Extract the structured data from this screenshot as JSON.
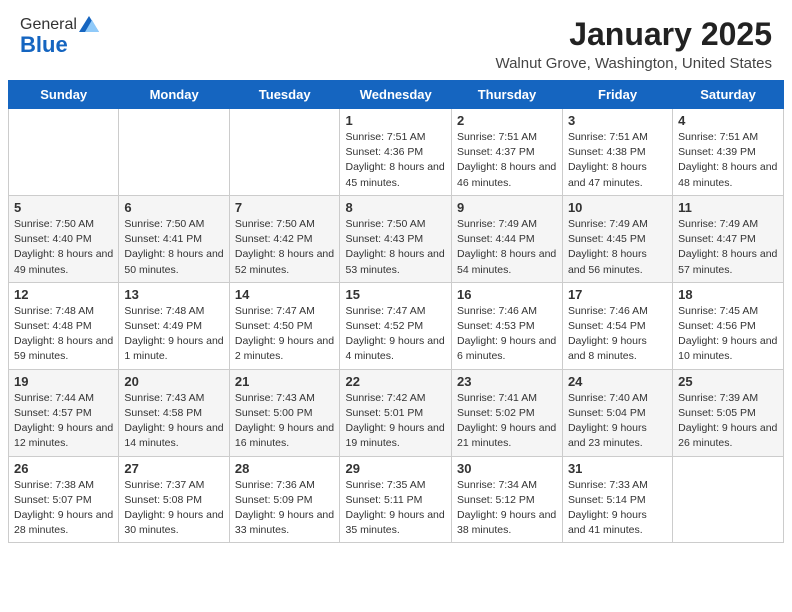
{
  "header": {
    "logo_general": "General",
    "logo_blue": "Blue",
    "month_year": "January 2025",
    "location": "Walnut Grove, Washington, United States"
  },
  "days_of_week": [
    "Sunday",
    "Monday",
    "Tuesday",
    "Wednesday",
    "Thursday",
    "Friday",
    "Saturday"
  ],
  "weeks": [
    [
      {
        "day": "",
        "info": ""
      },
      {
        "day": "",
        "info": ""
      },
      {
        "day": "",
        "info": ""
      },
      {
        "day": "1",
        "info": "Sunrise: 7:51 AM\nSunset: 4:36 PM\nDaylight: 8 hours and 45 minutes."
      },
      {
        "day": "2",
        "info": "Sunrise: 7:51 AM\nSunset: 4:37 PM\nDaylight: 8 hours and 46 minutes."
      },
      {
        "day": "3",
        "info": "Sunrise: 7:51 AM\nSunset: 4:38 PM\nDaylight: 8 hours and 47 minutes."
      },
      {
        "day": "4",
        "info": "Sunrise: 7:51 AM\nSunset: 4:39 PM\nDaylight: 8 hours and 48 minutes."
      }
    ],
    [
      {
        "day": "5",
        "info": "Sunrise: 7:50 AM\nSunset: 4:40 PM\nDaylight: 8 hours and 49 minutes."
      },
      {
        "day": "6",
        "info": "Sunrise: 7:50 AM\nSunset: 4:41 PM\nDaylight: 8 hours and 50 minutes."
      },
      {
        "day": "7",
        "info": "Sunrise: 7:50 AM\nSunset: 4:42 PM\nDaylight: 8 hours and 52 minutes."
      },
      {
        "day": "8",
        "info": "Sunrise: 7:50 AM\nSunset: 4:43 PM\nDaylight: 8 hours and 53 minutes."
      },
      {
        "day": "9",
        "info": "Sunrise: 7:49 AM\nSunset: 4:44 PM\nDaylight: 8 hours and 54 minutes."
      },
      {
        "day": "10",
        "info": "Sunrise: 7:49 AM\nSunset: 4:45 PM\nDaylight: 8 hours and 56 minutes."
      },
      {
        "day": "11",
        "info": "Sunrise: 7:49 AM\nSunset: 4:47 PM\nDaylight: 8 hours and 57 minutes."
      }
    ],
    [
      {
        "day": "12",
        "info": "Sunrise: 7:48 AM\nSunset: 4:48 PM\nDaylight: 8 hours and 59 minutes."
      },
      {
        "day": "13",
        "info": "Sunrise: 7:48 AM\nSunset: 4:49 PM\nDaylight: 9 hours and 1 minute."
      },
      {
        "day": "14",
        "info": "Sunrise: 7:47 AM\nSunset: 4:50 PM\nDaylight: 9 hours and 2 minutes."
      },
      {
        "day": "15",
        "info": "Sunrise: 7:47 AM\nSunset: 4:52 PM\nDaylight: 9 hours and 4 minutes."
      },
      {
        "day": "16",
        "info": "Sunrise: 7:46 AM\nSunset: 4:53 PM\nDaylight: 9 hours and 6 minutes."
      },
      {
        "day": "17",
        "info": "Sunrise: 7:46 AM\nSunset: 4:54 PM\nDaylight: 9 hours and 8 minutes."
      },
      {
        "day": "18",
        "info": "Sunrise: 7:45 AM\nSunset: 4:56 PM\nDaylight: 9 hours and 10 minutes."
      }
    ],
    [
      {
        "day": "19",
        "info": "Sunrise: 7:44 AM\nSunset: 4:57 PM\nDaylight: 9 hours and 12 minutes."
      },
      {
        "day": "20",
        "info": "Sunrise: 7:43 AM\nSunset: 4:58 PM\nDaylight: 9 hours and 14 minutes."
      },
      {
        "day": "21",
        "info": "Sunrise: 7:43 AM\nSunset: 5:00 PM\nDaylight: 9 hours and 16 minutes."
      },
      {
        "day": "22",
        "info": "Sunrise: 7:42 AM\nSunset: 5:01 PM\nDaylight: 9 hours and 19 minutes."
      },
      {
        "day": "23",
        "info": "Sunrise: 7:41 AM\nSunset: 5:02 PM\nDaylight: 9 hours and 21 minutes."
      },
      {
        "day": "24",
        "info": "Sunrise: 7:40 AM\nSunset: 5:04 PM\nDaylight: 9 hours and 23 minutes."
      },
      {
        "day": "25",
        "info": "Sunrise: 7:39 AM\nSunset: 5:05 PM\nDaylight: 9 hours and 26 minutes."
      }
    ],
    [
      {
        "day": "26",
        "info": "Sunrise: 7:38 AM\nSunset: 5:07 PM\nDaylight: 9 hours and 28 minutes."
      },
      {
        "day": "27",
        "info": "Sunrise: 7:37 AM\nSunset: 5:08 PM\nDaylight: 9 hours and 30 minutes."
      },
      {
        "day": "28",
        "info": "Sunrise: 7:36 AM\nSunset: 5:09 PM\nDaylight: 9 hours and 33 minutes."
      },
      {
        "day": "29",
        "info": "Sunrise: 7:35 AM\nSunset: 5:11 PM\nDaylight: 9 hours and 35 minutes."
      },
      {
        "day": "30",
        "info": "Sunrise: 7:34 AM\nSunset: 5:12 PM\nDaylight: 9 hours and 38 minutes."
      },
      {
        "day": "31",
        "info": "Sunrise: 7:33 AM\nSunset: 5:14 PM\nDaylight: 9 hours and 41 minutes."
      },
      {
        "day": "",
        "info": ""
      }
    ]
  ]
}
